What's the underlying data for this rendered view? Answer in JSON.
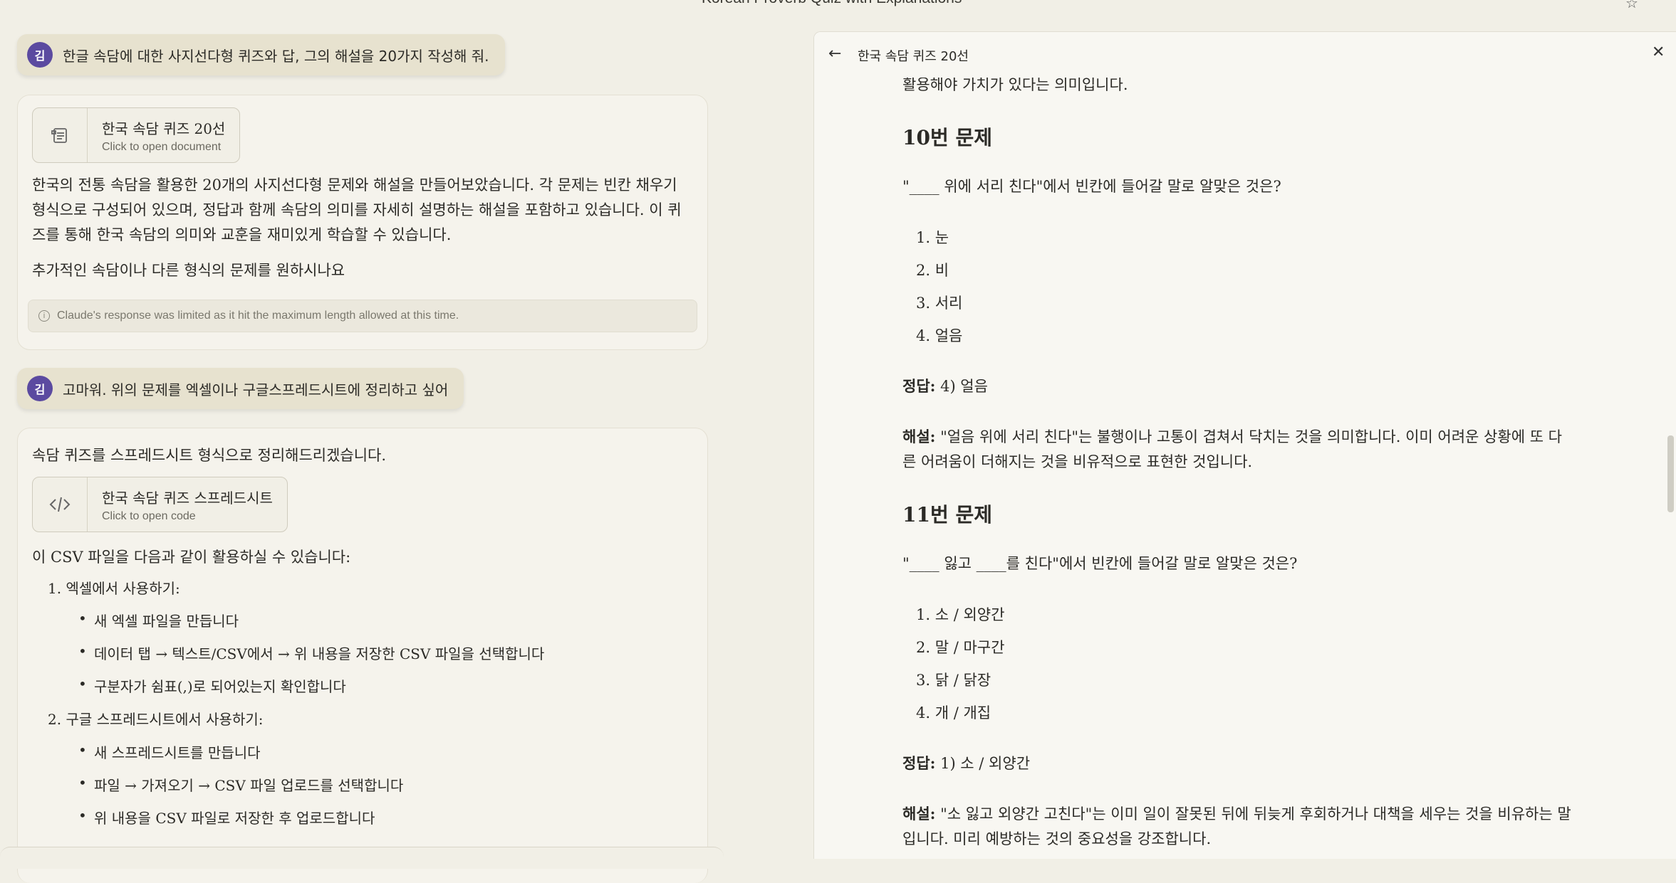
{
  "window": {
    "title": "Korean Proverb Quiz with Explanations"
  },
  "user_initial": "김",
  "messages": {
    "user1": "한글 속담에 대한 사지선다형 퀴즈와 답, 그의 해설을 20가지 작성해 줘.",
    "assistant1": {
      "artifact": {
        "title": "한국 속담 퀴즈 20선",
        "subtitle": "Click to open document"
      },
      "paragraphs": [
        "한국의 전통 속담을 활용한 20개의 사지선다형 문제와 해설을 만들어보았습니다. 각 문제는 빈칸 채우기 형식으로 구성되어 있으며, 정답과 함께 속담의 의미를 자세히 설명하는 해설을 포함하고 있습니다. 이 퀴즈를 통해 한국 속담의 의미와 교훈을 재미있게 학습할 수 있습니다.",
        "추가적인 속담이나 다른 형식의 문제를 원하시나요"
      ],
      "notice": "Claude's response was limited as it hit the maximum length allowed at this time."
    },
    "user2": "고마워. 위의 문제를 엑셀이나 구글스프레드시트에 정리하고 싶어",
    "assistant2": {
      "intro": "속담 퀴즈를 스프레드시트 형식으로 정리해드리겠습니다.",
      "artifact": {
        "title": "한국 속담 퀴즈 스프레드시트",
        "subtitle": "Click to open code"
      },
      "usage_intro": "이 CSV 파일을 다음과 같이 활용하실 수 있습니다:",
      "steps": [
        {
          "label": "1. 엑셀에서 사용하기:",
          "bullets": [
            "새 엑셀 파일을 만듭니다",
            "데이터 탭 → 텍스트/CSV에서 → 위 내용을 저장한 CSV 파일을 선택합니다",
            "구분자가 쉼표(,)로 되어있는지 확인합니다"
          ]
        },
        {
          "label": "2. 구글 스프레드시트에서 사용하기:",
          "bullets": [
            "새 스프레드시트를 만듭니다",
            "파일 → 가져오기 → CSV 파일 업로드를 선택합니다",
            "위 내용을 CSV 파일로 저장한 후 업로드합니다"
          ]
        }
      ]
    }
  },
  "document": {
    "title": "한국 속담 퀴즈 20선",
    "top_partial": "활용해야 가치가 있다는 의미입니다.",
    "q10": {
      "heading": "10번 문제",
      "question": "\"____ 위에 서리 친다\"에서 빈칸에 들어갈 말로 알맞은 것은?",
      "options": [
        "1. 눈",
        "2. 비",
        "3. 서리",
        "4. 얼음"
      ],
      "answer_label": "정답:",
      "answer": " 4) 얼음",
      "exp_label": "해설:",
      "explanation": " \"얼음 위에 서리 친다\"는 불행이나 고통이 겹쳐서 닥치는 것을 의미합니다. 이미 어려운 상황에 또 다른 어려움이 더해지는 것을 비유적으로 표현한 것입니다."
    },
    "q11": {
      "heading": "11번 문제",
      "question": "\"____ 잃고 ____를 친다\"에서 빈칸에 들어갈 말로 알맞은 것은?",
      "options": [
        "1. 소 / 외양간",
        "2. 말 / 마구간",
        "3. 닭 / 닭장",
        "4. 개 / 개집"
      ],
      "answer_label": "정답:",
      "answer": " 1) 소 / 외양간",
      "exp_label": "해설:",
      "explanation": " \"소 잃고 외양간 고친다\"는 이미 일이 잘못된 뒤에 뒤늦게 후회하거나 대책을 세우는 것을 비유하는 말입니다. 미리 예방하는 것의 중요성을 강조합니다."
    }
  }
}
